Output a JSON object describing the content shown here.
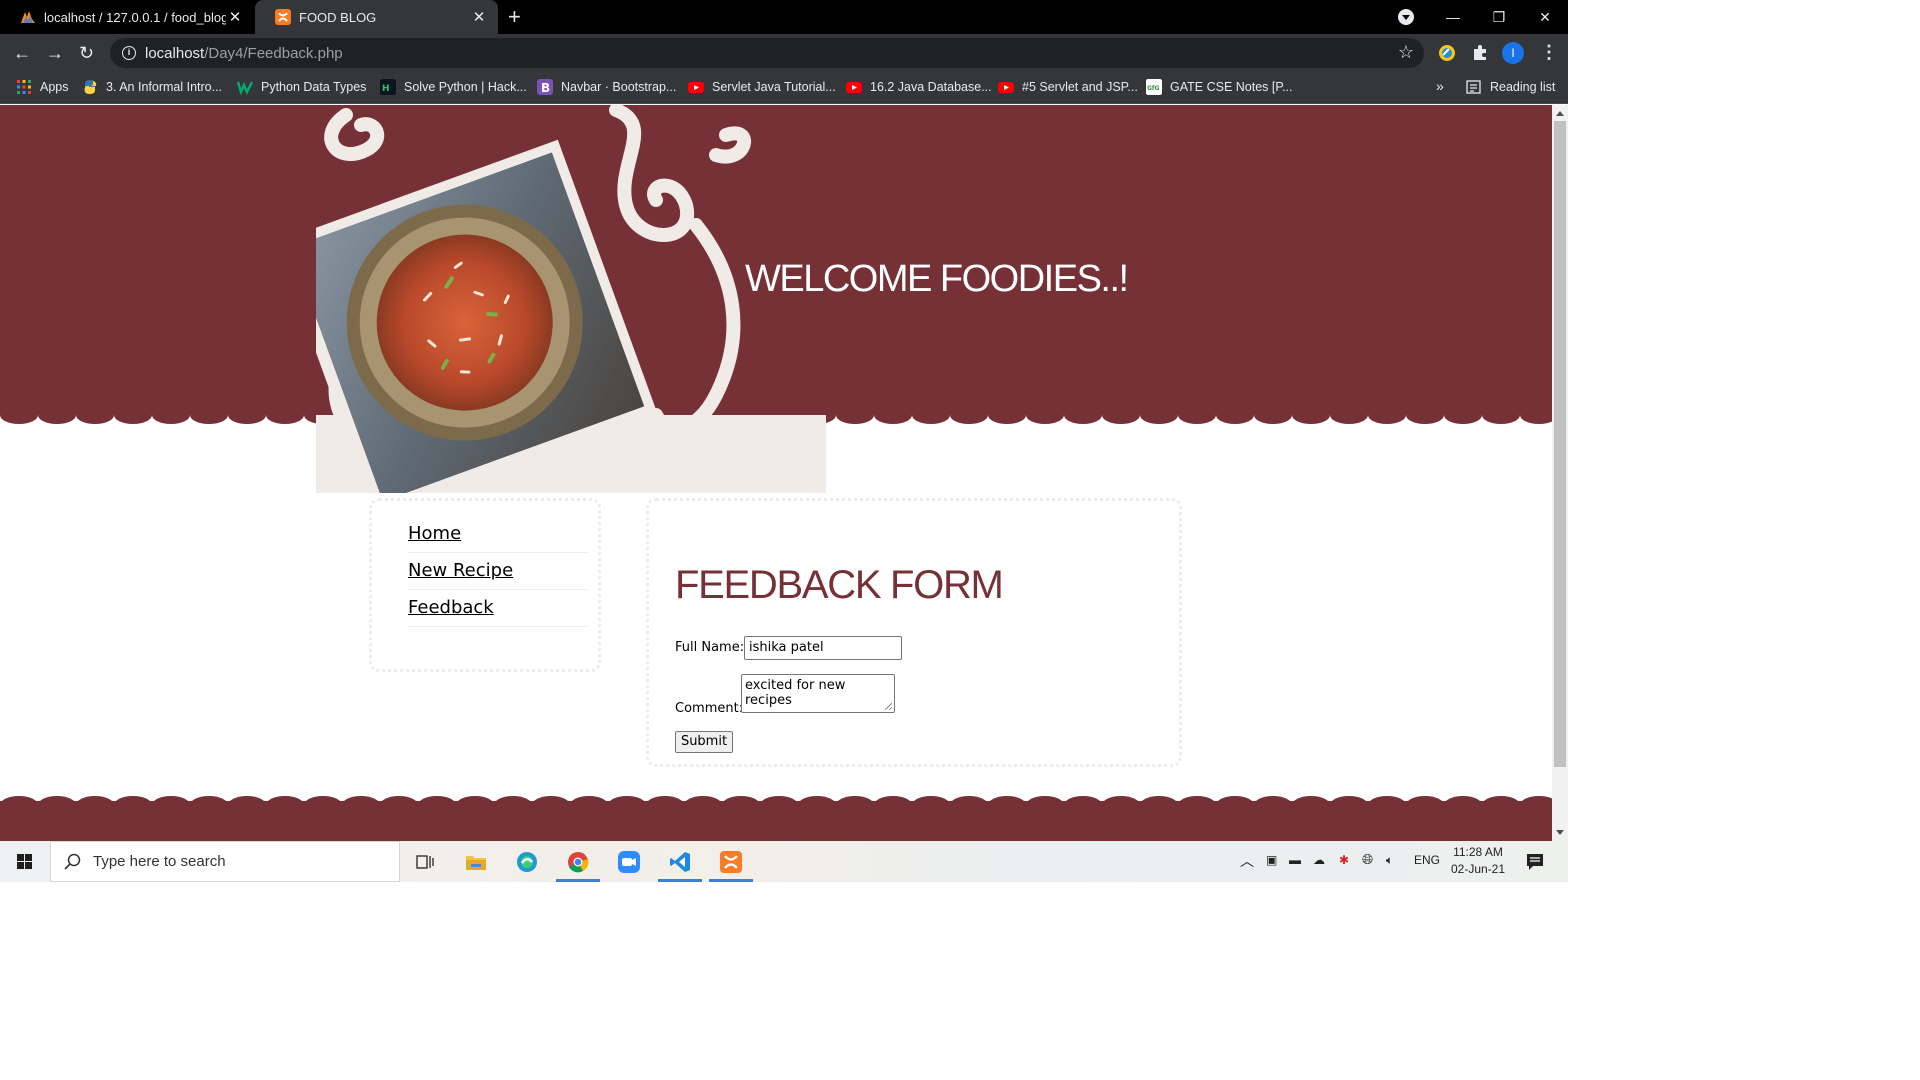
{
  "browser": {
    "tabs": [
      {
        "title": "localhost / 127.0.0.1 / food_blog",
        "active": false,
        "icon": "phpmyadmin-icon"
      },
      {
        "title": "FOOD BLOG",
        "active": true,
        "icon": "xampp-icon"
      }
    ],
    "address": {
      "host": "localhost",
      "path": "/Day4/Feedback.php"
    },
    "bookmarks": [
      {
        "label": "Apps",
        "icon": "apps-grid-icon"
      },
      {
        "label": "3. An Informal Intro...",
        "icon": "python-icon"
      },
      {
        "label": "Python Data Types",
        "icon": "w3schools-icon"
      },
      {
        "label": "Solve Python | Hack...",
        "icon": "hackerrank-icon"
      },
      {
        "label": "Navbar · Bootstrap...",
        "icon": "bootstrap-icon"
      },
      {
        "label": "Servlet Java Tutorial...",
        "icon": "youtube-icon"
      },
      {
        "label": "16.2 Java Database...",
        "icon": "youtube-icon"
      },
      {
        "label": "#5 Servlet and JSP...",
        "icon": "youtube-icon"
      },
      {
        "label": "GATE CSE Notes [P...",
        "icon": "gfg-icon"
      }
    ],
    "overflow": "»",
    "reading_list": "Reading list",
    "profile_initial": "I"
  },
  "page": {
    "welcome": "WELCOME FOODIES..!",
    "nav": [
      "Home",
      "New Recipe",
      "Feedback"
    ],
    "form": {
      "title": "FEEDBACK FORM",
      "name_label": "Full Name:",
      "name_value": "ishika  patel",
      "comment_label": "Comment:",
      "comment_value": "excited for new recipes",
      "submit": "Submit"
    },
    "colors": {
      "maroon": "#763136",
      "cream": "#f1ebe8"
    }
  },
  "taskbar": {
    "search_placeholder": "Type here to search",
    "lang": "ENG",
    "time": "11:28 AM",
    "date": "02-Jun-21"
  }
}
